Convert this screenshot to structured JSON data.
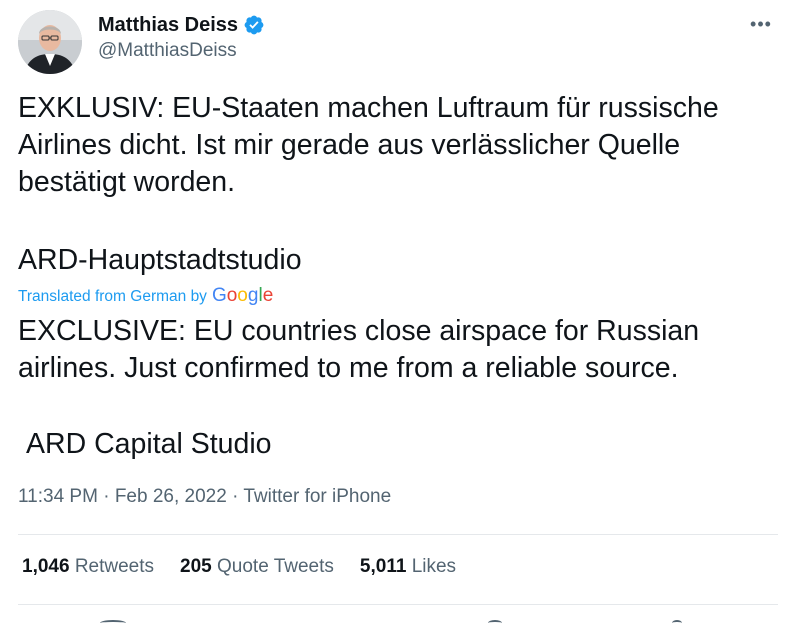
{
  "author": {
    "display_name": "Matthias Deiss",
    "handle": "@MatthiasDeiss",
    "verified": true
  },
  "tweet": {
    "original_text": "EXKLUSIV: EU-Staaten machen Luftraum für russische Airlines dicht. Ist mir gerade aus verlässlicher Quelle bestätigt worden.",
    "original_source": "ARD-Hauptstadtstudio",
    "translated_label": "Translated from German by",
    "translated_provider": "Google",
    "translated_text": "EXCLUSIVE: EU countries close airspace for Russian airlines. Just confirmed to me from a reliable source.",
    "translated_source": "ARD Capital Studio"
  },
  "meta": {
    "time": "11:34 PM",
    "separator": "·",
    "date": "Feb 26, 2022",
    "client": "Twitter for iPhone"
  },
  "stats": {
    "retweets_count": "1,046",
    "retweets_label": "Retweets",
    "quotes_count": "205",
    "quotes_label": "Quote Tweets",
    "likes_count": "5,011",
    "likes_label": "Likes"
  },
  "icons": {
    "more": "more-options-icon",
    "verified": "verified-badge-icon"
  },
  "colors": {
    "link": "#1d9bf0",
    "secondary_text": "#536471",
    "primary_text": "#0f1419"
  }
}
